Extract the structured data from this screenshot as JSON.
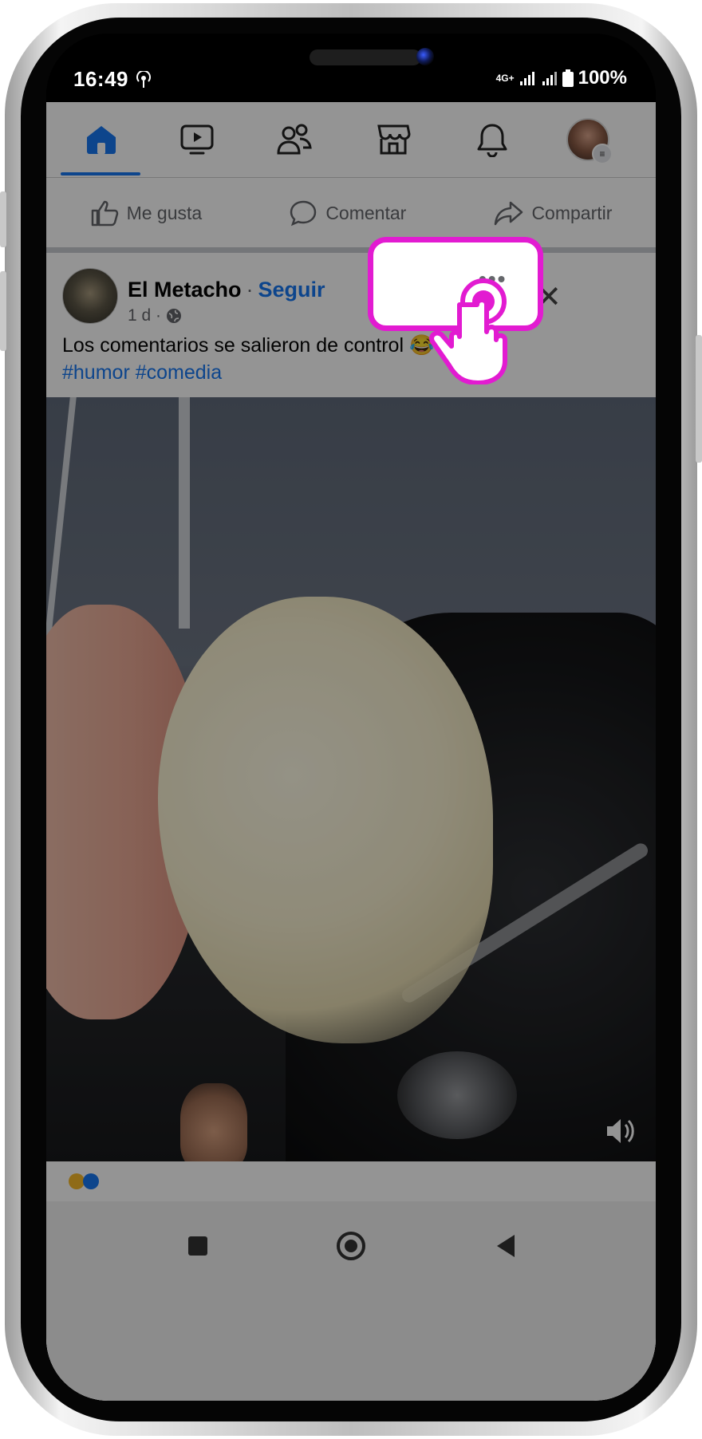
{
  "status_bar": {
    "time": "16:49",
    "network": "4G+",
    "battery": "100%"
  },
  "nav": {
    "items": [
      {
        "name": "home",
        "icon": "home-icon",
        "active": true
      },
      {
        "name": "video",
        "icon": "video-icon",
        "active": false
      },
      {
        "name": "friends",
        "icon": "friends-icon",
        "active": false
      },
      {
        "name": "marketplace",
        "icon": "marketplace-icon",
        "active": false
      },
      {
        "name": "notifications",
        "icon": "bell-icon",
        "active": false
      },
      {
        "name": "profile-menu",
        "icon": "avatar",
        "active": false
      }
    ],
    "accent": "#1877f2"
  },
  "actions": {
    "like": "Me gusta",
    "comment": "Comentar",
    "share": "Compartir"
  },
  "post": {
    "author": "El Metacho",
    "separator": "·",
    "follow": "Seguir",
    "time": "1 d ·",
    "text": "Los comentarios se salieron de control 😂",
    "hashtags": "#humor #comedia",
    "more": "•••",
    "close": "✕"
  },
  "highlight": {
    "color": "#e21bd1",
    "target": "more-options-button"
  }
}
